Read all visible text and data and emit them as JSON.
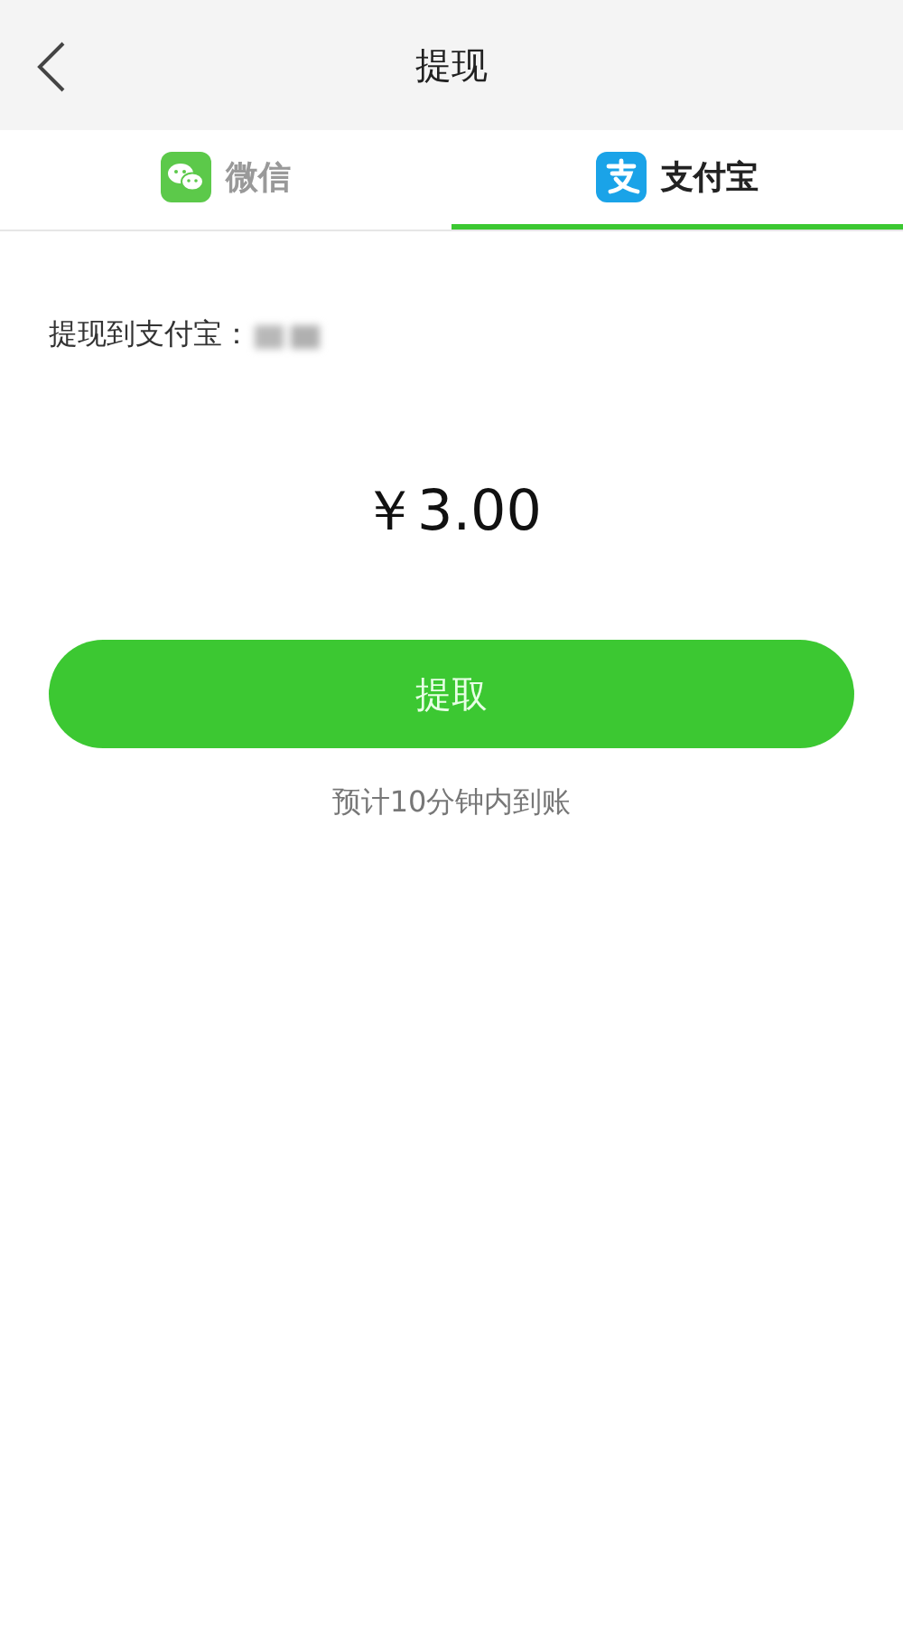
{
  "header": {
    "title": "提现"
  },
  "tabs": [
    {
      "label": "微信",
      "kind": "wechat",
      "selected": false
    },
    {
      "label": "支付宝",
      "kind": "alipay",
      "selected": true
    }
  ],
  "withdraw": {
    "label": "提现到支付宝：",
    "amount": "￥3.00",
    "button": "提取",
    "hint": "预计10分钟内到账"
  }
}
